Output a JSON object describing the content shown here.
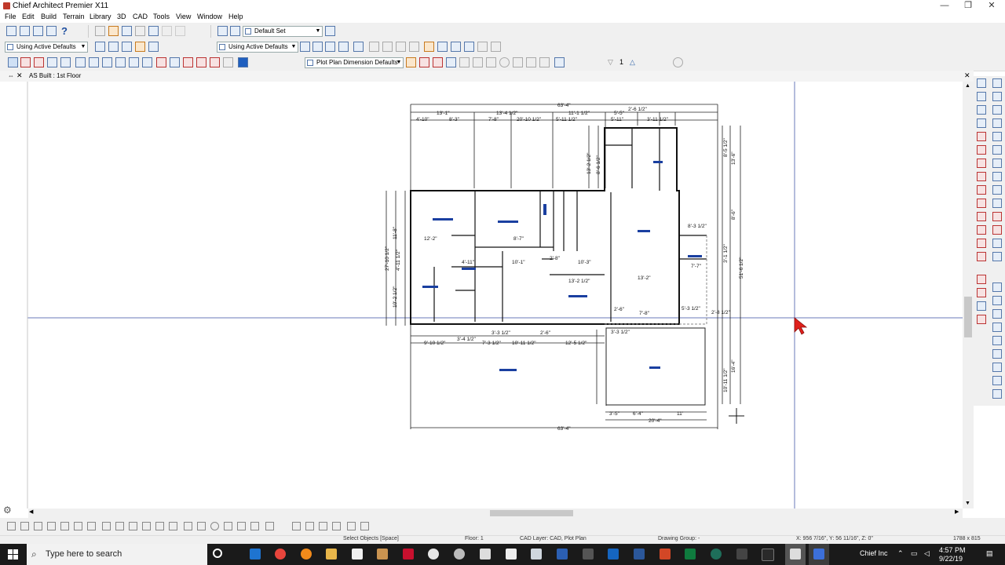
{
  "window": {
    "title": "Chief Architect Premier X11",
    "minimize": "—",
    "maximize": "❐",
    "close": "✕"
  },
  "menu": [
    "File",
    "Edit",
    "Build",
    "Terrain",
    "Library",
    "3D",
    "CAD",
    "Tools",
    "View",
    "Window",
    "Help"
  ],
  "toolbar": {
    "default_set": "Default Set",
    "using_active_defaults_1": "Using Active Defaults",
    "using_active_defaults_2": "Using Active Defaults",
    "using_active_defaults_3": "Using Active Defaults",
    "plot_plan_dim": "Plot Plan Dimension Defaults",
    "floor_number": "1",
    "help_glyph": "?"
  },
  "view_tab": {
    "label": "AS Built : 1st Floor",
    "close": "✕",
    "close_right": "✕"
  },
  "plan": {
    "dims_top": [
      "63'-4\"",
      "13'-1\"",
      "13'-4 1/2\"",
      "11'-1 1/2\"",
      "5'-5\"",
      "2'-6 1/2\"",
      "4'-10\"",
      "8'-3\"",
      "7'-8\"",
      "20'-10 1/2\"",
      "5'-11 1/2\"",
      "5'-11\"",
      "3'-11 1/2\""
    ],
    "dims_bottom": [
      "63'-4\"",
      "20'-4\"",
      "3'-5\"",
      "6'-4\"",
      "11'",
      "9'-10 1/2\"",
      "3'-4 1/2\"",
      "7'-3 1/2\"",
      "10'-11 1/2\"",
      "2'-6\"",
      "12'-5 1/2\"",
      "3'-3 1/2\"",
      "3'-3 1/2\""
    ],
    "dims_left": [
      "27'-10 1/2\"",
      "11'-8\"",
      "10'-2 1/2\"",
      "4'-11 1/2\""
    ],
    "dims_right": [
      "51'-6 1/2\"",
      "13'-6\"",
      "8'-6\"",
      "16'-4\"",
      "10'-11 1/2\"",
      "8'-5 1/2\"",
      "3'-1 1/2\""
    ],
    "dims_inner": [
      "13'-2 1/2\"",
      "8'-6 1/2\"",
      "13'-2\"",
      "8'-3 1/2\"",
      "7'-7\"",
      "5'-3 1/2\"",
      "10'-3\"",
      "12'-2\"",
      "8'-7\"",
      "4'-11\"",
      "2'-8\"",
      "13'-2 1/2\"",
      "2'-6\"",
      "7'-8\"",
      "2'-8 1/2\"",
      "10'-1\""
    ]
  },
  "status": {
    "hint": "Select Objects [Space]",
    "floor": "Floor: 1",
    "cad_layer": "CAD Layer: CAD, Plot Plan",
    "drawing_group": "Drawing Group: -",
    "coords": "X: 956 7/16\", Y: 56 11/16\", Z: 0\"",
    "size": "1788 x 815"
  },
  "taskbar": {
    "search_placeholder": "Type here to search",
    "user": "Chief Inc",
    "time": "4:57 PM",
    "date": "9/22/19"
  },
  "colors": {
    "cursor": "#e0201c",
    "plan_lines": "#222222",
    "room_labels": "#1a3fa0",
    "taskbar": "#1a1a1a"
  }
}
